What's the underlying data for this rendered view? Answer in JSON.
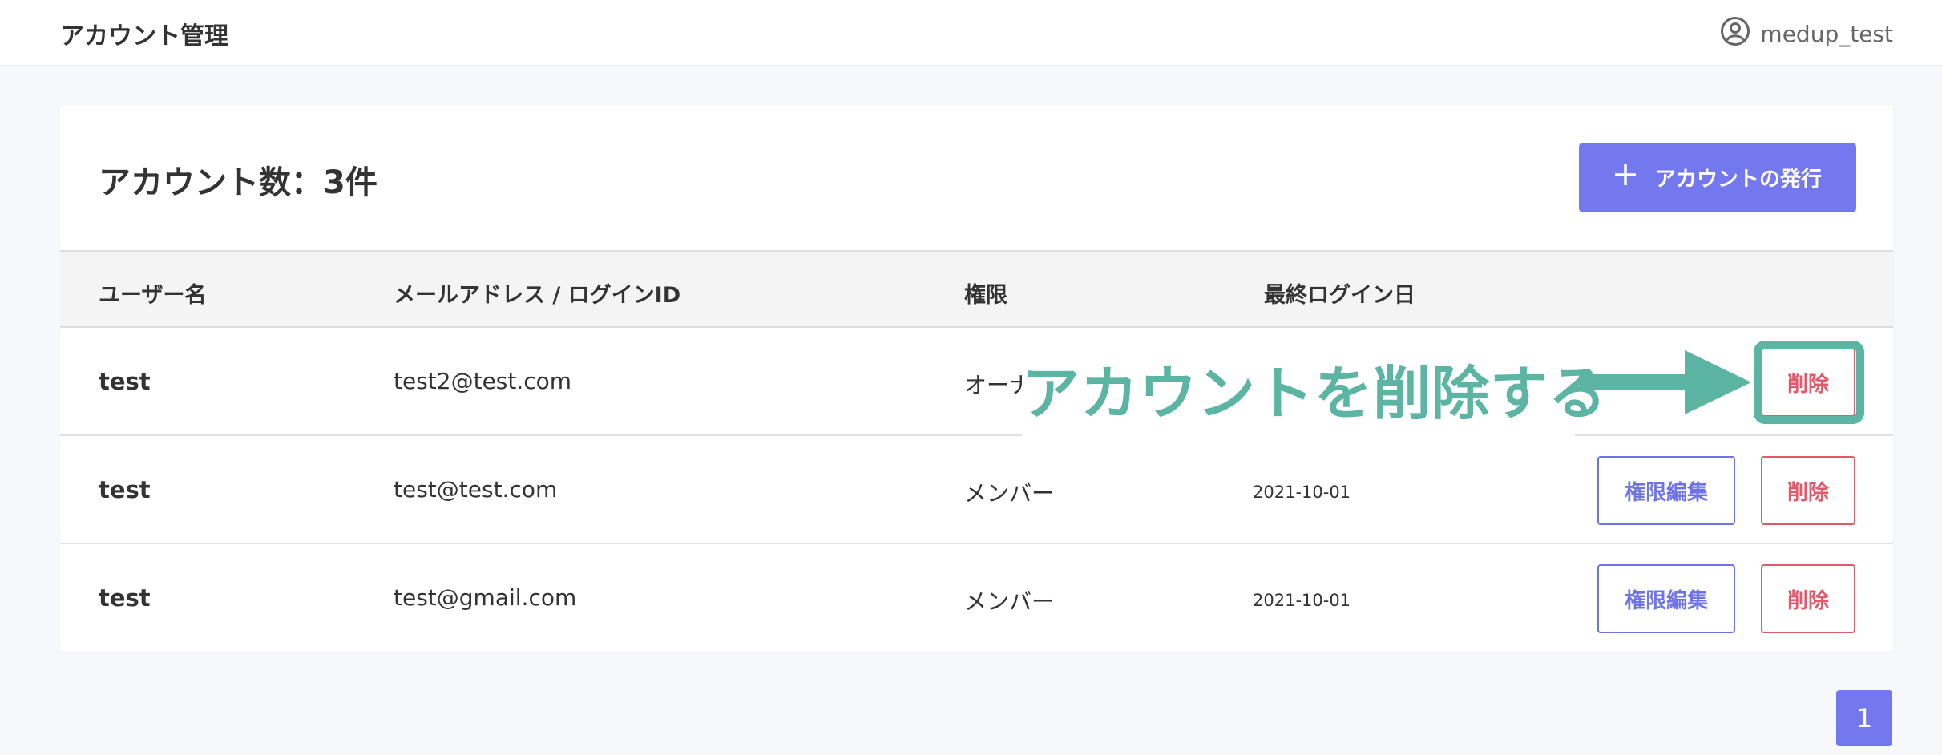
{
  "header": {
    "title": "アカウント管理",
    "user_name": "medup_test",
    "user_icon": "user-circle-icon"
  },
  "card": {
    "title": "アカウント数：3件",
    "issue_button": {
      "icon": "plus-icon",
      "label": "アカウントの発行"
    }
  },
  "table": {
    "columns": [
      "ユーザー名",
      "メールアドレス / ログインID",
      "権限",
      "最終ログイン日"
    ],
    "rows": [
      {
        "name": "test",
        "email": "test2@test.com",
        "role": "オーナー",
        "last_login": "",
        "edit_label": "",
        "delete_label": "削除"
      },
      {
        "name": "test",
        "email": "test@test.com",
        "role": "メンバー",
        "last_login": "2021-10-01",
        "edit_label": "権限編集",
        "delete_label": "削除"
      },
      {
        "name": "test",
        "email": "test@gmail.com",
        "role": "メンバー",
        "last_login": "2021-10-01",
        "edit_label": "権限編集",
        "delete_label": "削除"
      }
    ]
  },
  "annotation": {
    "text": "アカウントを削除する",
    "color": "#5bb5a2"
  },
  "pagination": {
    "current": "1"
  },
  "colors": {
    "accent": "#7478ee",
    "danger": "#e05a6b",
    "annotation": "#5bb5a2"
  }
}
